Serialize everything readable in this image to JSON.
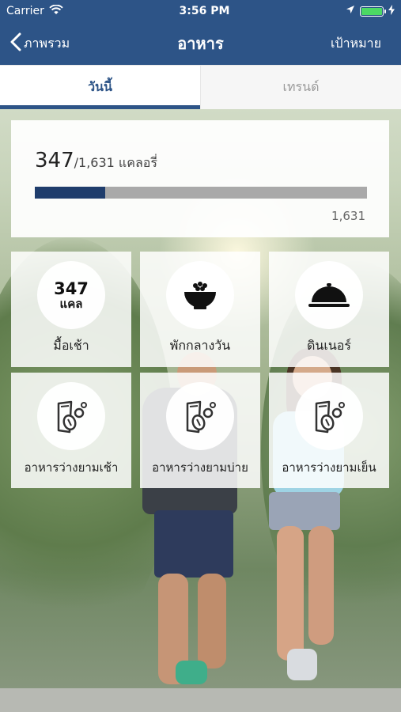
{
  "status_bar": {
    "carrier": "Carrier",
    "time": "3:56 PM"
  },
  "nav": {
    "back_label": "ภาพรวม",
    "title": "อาหาร",
    "right_label": "เป้าหมาย"
  },
  "tabs": [
    {
      "label": "วันนี้",
      "active": true
    },
    {
      "label": "เทรนด์",
      "active": false
    }
  ],
  "calories": {
    "consumed": "347",
    "goal_text": "/1,631 แคลอรี่",
    "goal_number": "1,631",
    "progress_fraction": 0.213
  },
  "meals": [
    {
      "label": "มื้อเช้า",
      "value": "347",
      "unit": "แคล",
      "icon": "kcal-value"
    },
    {
      "label": "พักกลางวัน",
      "icon": "rice-bowl-icon"
    },
    {
      "label": "ดินเนอร์",
      "icon": "cloche-icon"
    },
    {
      "label": "อาหารว่างยามเช้า",
      "icon": "snack-icon"
    },
    {
      "label": "อาหารว่างยามบ่าย",
      "icon": "snack-icon"
    },
    {
      "label": "อาหารว่างยามเย็น",
      "icon": "snack-icon"
    }
  ],
  "colors": {
    "nav": "#2d5487",
    "progress": "#1f3d6c",
    "battery": "#4cd964"
  }
}
